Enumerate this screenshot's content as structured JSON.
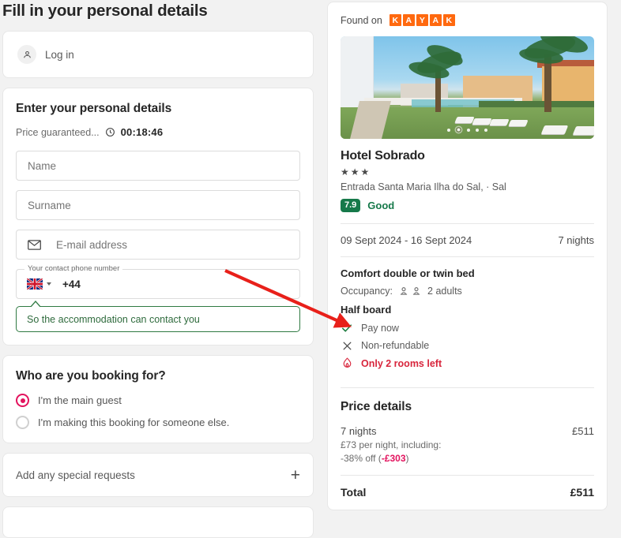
{
  "left": {
    "page_title": "Fill in your personal details",
    "login": {
      "label": "Log in",
      "icon": "user-icon"
    },
    "personal_details": {
      "heading": "Enter your personal details",
      "guarantee_text": "Price guaranteed...",
      "timer": "00:18:46",
      "fields": [
        {
          "name": "name",
          "placeholder": "Name",
          "value": "",
          "icon": ""
        },
        {
          "name": "surname",
          "placeholder": "Surname",
          "value": "",
          "icon": ""
        },
        {
          "name": "email",
          "placeholder": "E-mail address",
          "value": "",
          "icon": "envelope-icon"
        }
      ],
      "phone": {
        "legend": "Your contact phone number",
        "flag": "uk-flag-icon",
        "dial_code": "+44",
        "value": ""
      },
      "tooltip": "So the accommodation can contact you"
    },
    "booking_for": {
      "heading": "Who are you booking for?",
      "options": [
        {
          "label": "I'm the main guest",
          "selected": true
        },
        {
          "label": "I'm making this booking for someone else.",
          "selected": false
        }
      ]
    },
    "special_requests": {
      "label": "Add any special requests",
      "icon": "plus-icon"
    }
  },
  "right": {
    "found_on_label": "Found on",
    "provider_logo_letters": [
      "K",
      "A",
      "Y",
      "A",
      "K"
    ],
    "carousel": {
      "total_dots": 5,
      "active_index": 1
    },
    "hotel": {
      "name": "Hotel Sobrado",
      "star_rating": 3,
      "stars_glyph": "★★★",
      "address": "Entrada Santa Maria Ilha do Sal, · Sal",
      "score": "7.9",
      "score_word": "Good"
    },
    "stay": {
      "date_range": "09 Sept 2024 - 16 Sept 2024",
      "nights_label": "7 nights"
    },
    "room": {
      "title": "Comfort double or twin bed",
      "occupancy_label": "Occupancy:",
      "occupancy_value": "2 adults",
      "board": "Half board",
      "features": [
        {
          "label": "Pay now",
          "icon": "check-icon",
          "style": "normal"
        },
        {
          "label": "Non-refundable",
          "icon": "cross-icon",
          "style": "normal"
        },
        {
          "label": "Only 2 rooms left",
          "icon": "flame-icon",
          "style": "urgent"
        }
      ]
    },
    "price": {
      "heading": "Price details",
      "nights_label": "7 nights",
      "nights_amount": "£511",
      "per_night": "£73 per night, including:",
      "discount_prefix": "-38% off (",
      "discount_amount": "-£303",
      "discount_suffix": ")",
      "total_label": "Total",
      "total_amount": "£511"
    }
  },
  "colors": {
    "accent_pink": "#e3135e",
    "brand_orange": "#ff690f",
    "score_green": "#16794a",
    "urgent_red": "#d8253c",
    "annotation_red": "#e8201a",
    "page_bg": "#f2f2f2"
  }
}
